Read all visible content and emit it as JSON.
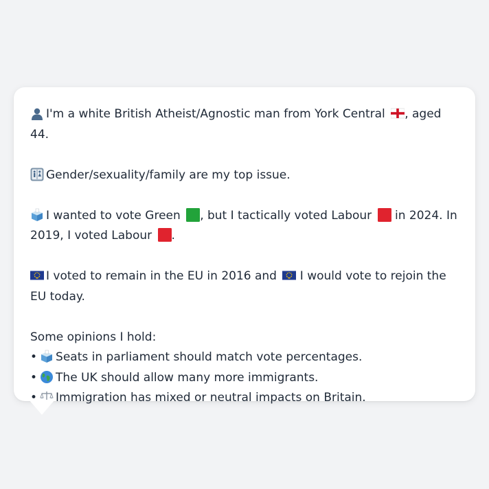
{
  "profile": {
    "intro": {
      "icon": "person-silhouette-icon",
      "text": "I'm a white British Atheist/Agnostic man from York Central",
      "flag_icon": "england-flag-icon",
      "suffix": ", aged 44."
    },
    "top_issue": {
      "icon": "restroom-icon",
      "text": "Gender/sexuality/family are my top issue."
    },
    "vote": {
      "icon": "ballot-box-icon",
      "part1": "I wanted to vote Green",
      "green_icon": "green-square-icon",
      "part2": ", but I tactically voted Labour",
      "red_icon": "red-square-icon",
      "part3": "in 2024. In",
      "part4": "2019, I voted Labour",
      "red_icon_2": "red-square-icon",
      "part5": "."
    },
    "eu": {
      "icon": "eu-flag-icon",
      "part1": "I voted to remain in the EU in 2016 and",
      "icon2": "eu-flag-icon",
      "part2": "I would vote to rejoin the EU",
      "part3": "today."
    },
    "opinions": {
      "heading": "Some opinions I hold:",
      "bullet": "•",
      "items": [
        {
          "icon": "ballot-box-icon",
          "text": "Seats in parliament should match vote percentages."
        },
        {
          "icon": "globe-icon",
          "text": "The UK should allow many more immigrants."
        },
        {
          "icon": "balance-scale-icon",
          "text": "Immigration has mixed or neutral impacts on Britain."
        }
      ]
    }
  },
  "colors": {
    "background": "#f2f3f5",
    "card": "#ffffff",
    "text": "#1f2937",
    "green": "#22a33a",
    "red": "#e0232e",
    "eu_blue": "#1f3a8f",
    "eu_gold": "#ffcc00"
  }
}
